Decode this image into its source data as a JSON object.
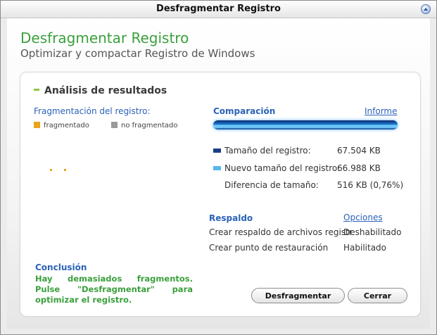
{
  "window": {
    "title": "Desfragmentar Registro"
  },
  "header": {
    "title": "Desfragmentar Registro",
    "subtitle": "Optimizar y compactar Registro de Windows"
  },
  "analysis": {
    "section_title": "Análisis de resultados",
    "fragmentation_heading": "Fragmentación del registro:",
    "legend": [
      {
        "label": "fragmentado",
        "color": "#e8a41c"
      },
      {
        "label": "no fragmentado",
        "color": "#9a9a9a"
      }
    ]
  },
  "conclusion": {
    "title": "Conclusión",
    "text": "Hay demasiados fragmentos. Pulse \"Desfragmentar\" para optimizar el registro."
  },
  "comparison": {
    "heading": "Comparación",
    "report_link": "Informe",
    "bar_colors": [
      "#0a2a6a",
      "#7ad2ff"
    ],
    "rows": [
      {
        "label": "Tamaño del registro:",
        "value": "67.504 KB",
        "key_color": "#1b3f86"
      },
      {
        "label": "Nuevo tamaño del registro:",
        "value": "66.988 KB",
        "key_color": "#56b8ec"
      },
      {
        "label": "Diferencia de tamaño:",
        "value": "516 KB (0,76%)"
      }
    ]
  },
  "backup": {
    "heading": "Respaldo",
    "options_link": "Opciones",
    "rows": [
      {
        "label": "Crear respaldo de archivos registr",
        "value": "Deshabilitado"
      },
      {
        "label": "Crear punto de restauración",
        "value": "Habilitado"
      }
    ]
  },
  "buttons": {
    "defrag": "Desfragmentar",
    "close": "Cerrar"
  }
}
